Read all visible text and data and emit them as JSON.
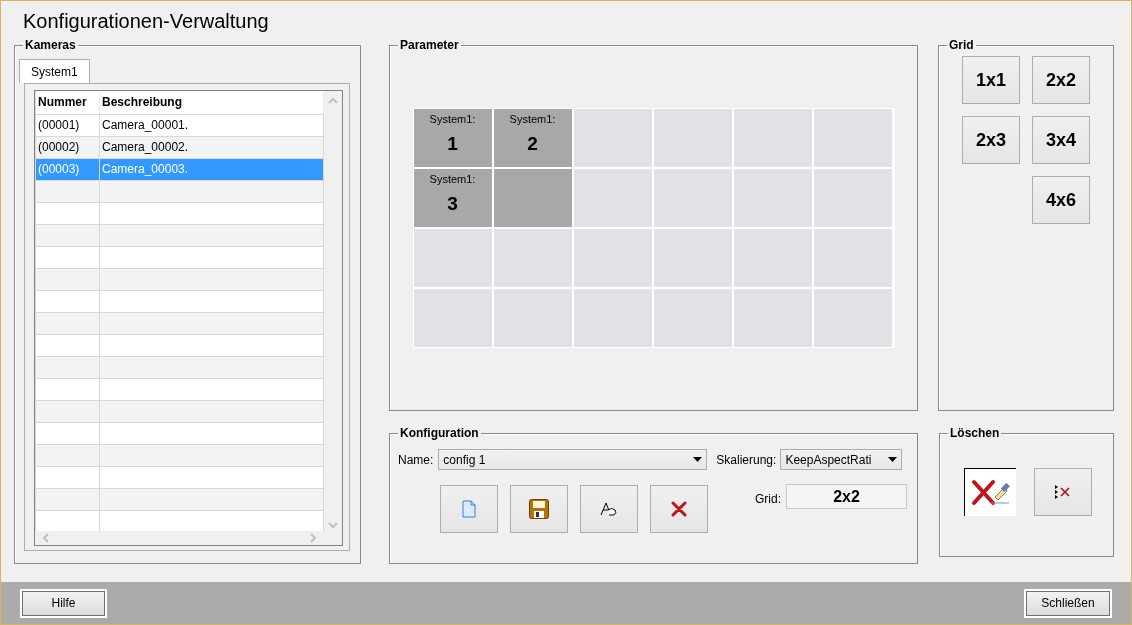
{
  "window": {
    "title": "Konfigurationen-Verwaltung"
  },
  "cameras": {
    "legend": "Kameras",
    "tabs": [
      {
        "label": "System1",
        "selected": true
      }
    ],
    "table": {
      "columns": [
        "Nummer",
        "Beschreibung"
      ],
      "rows": [
        {
          "cells": [
            "(00001)",
            "Camera_00001."
          ],
          "selected": false
        },
        {
          "cells": [
            "(00002)",
            "Camera_00002."
          ],
          "selected": false
        },
        {
          "cells": [
            "(00003)",
            "Camera_00003."
          ],
          "selected": true
        }
      ]
    }
  },
  "parameter": {
    "legend": "Parameter",
    "cells": [
      [
        {
          "occupied": true,
          "label": "System1:",
          "number": "1"
        },
        {
          "occupied": true,
          "label": "System1:",
          "number": "2"
        },
        {
          "occupied": false
        },
        {
          "occupied": false
        },
        {
          "occupied": false
        },
        {
          "occupied": false
        }
      ],
      [
        {
          "occupied": true,
          "label": "System1:",
          "number": "3"
        },
        {
          "occupied": true
        },
        {
          "occupied": false
        },
        {
          "occupied": false
        },
        {
          "occupied": false
        },
        {
          "occupied": false
        }
      ],
      [
        {
          "occupied": false
        },
        {
          "occupied": false
        },
        {
          "occupied": false
        },
        {
          "occupied": false
        },
        {
          "occupied": false
        },
        {
          "occupied": false
        }
      ],
      [
        {
          "occupied": false
        },
        {
          "occupied": false
        },
        {
          "occupied": false
        },
        {
          "occupied": false
        },
        {
          "occupied": false
        },
        {
          "occupied": false
        }
      ]
    ]
  },
  "grid": {
    "legend": "Grid",
    "buttons": [
      {
        "label": "1x1"
      },
      {
        "label": "2x2"
      },
      {
        "label": "2x3"
      },
      {
        "label": "3x4"
      },
      {
        "label": "4x6"
      }
    ]
  },
  "configuration": {
    "legend": "Konfiguration",
    "name_label": "Name:",
    "name_value": "config 1",
    "scaling_label": "Skalierung:",
    "scaling_value": "KeepAspectRati",
    "grid_label": "Grid:",
    "grid_value": "2x2",
    "buttons": [
      {
        "kind": "new"
      },
      {
        "kind": "save"
      },
      {
        "kind": "rename"
      },
      {
        "kind": "delete"
      }
    ]
  },
  "delete": {
    "legend": "Löschen",
    "buttons": [
      {
        "kind": "clear-all",
        "selected": true
      },
      {
        "kind": "remove-marked",
        "selected": false
      }
    ]
  },
  "footer": {
    "help": "Hilfe",
    "close": "Schließen"
  }
}
